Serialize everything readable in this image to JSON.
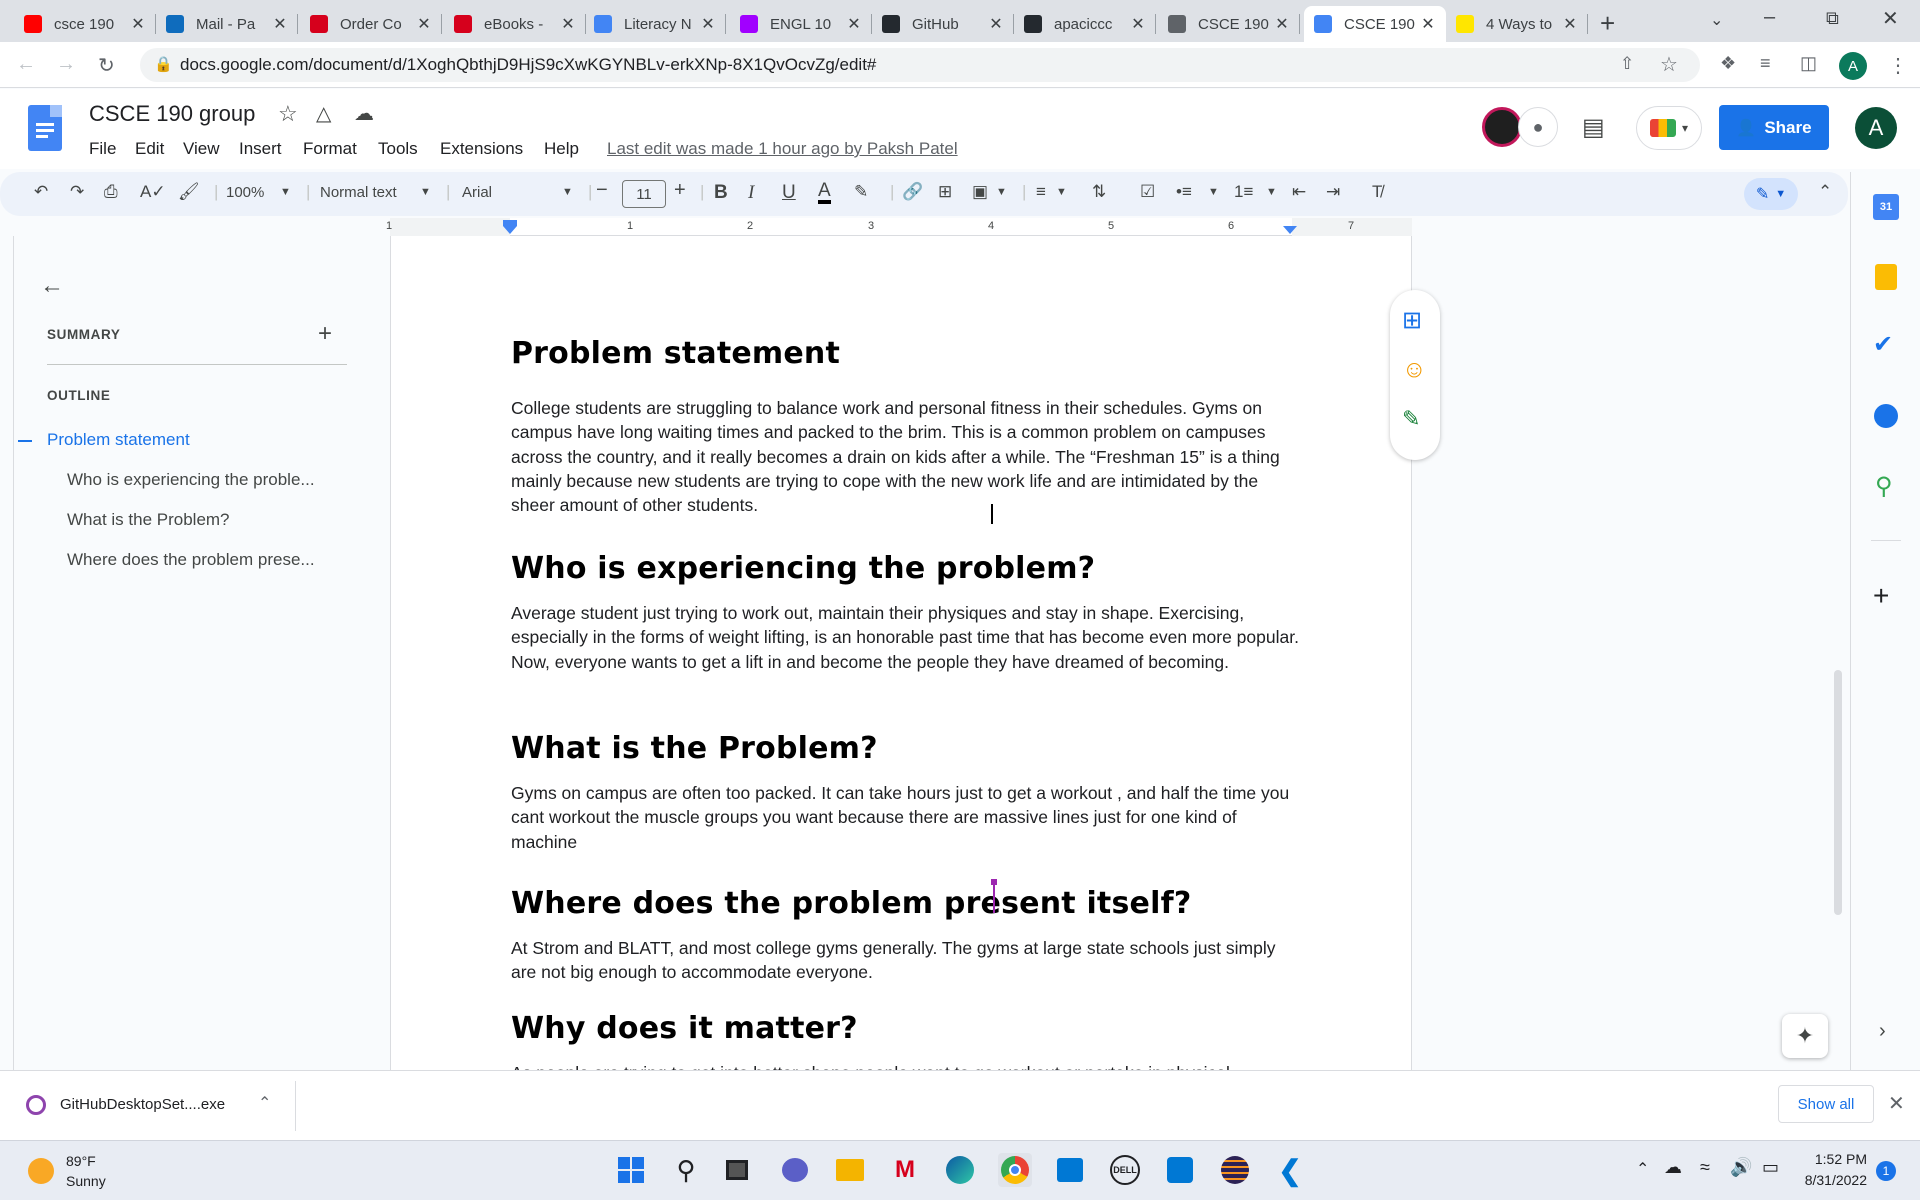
{
  "browser": {
    "tabs": [
      {
        "title": "csce 190",
        "icon": "youtube-icon",
        "color": "#ff0000"
      },
      {
        "title": "Mail - Pa",
        "icon": "outlook-icon",
        "color": "#0f6cbd"
      },
      {
        "title": "Order Co",
        "icon": "mcgraw-hill-icon",
        "color": "#d6001c"
      },
      {
        "title": "eBooks -",
        "icon": "mcgraw-hill-icon",
        "color": "#d6001c"
      },
      {
        "title": "Literacy N",
        "icon": "google-docs-icon",
        "color": "#4285f4"
      },
      {
        "title": "ENGL 10",
        "icon": "tophat-icon",
        "color": "#a100ff"
      },
      {
        "title": "GitHub",
        "icon": "github-icon",
        "color": "#24292f"
      },
      {
        "title": "apaciccc",
        "icon": "github-icon",
        "color": "#24292f"
      },
      {
        "title": "CSCE 190",
        "icon": "globe-icon",
        "color": "#5f6368"
      },
      {
        "title": "CSCE 190",
        "icon": "google-docs-icon",
        "color": "#4285f4"
      },
      {
        "title": "4 Ways to",
        "icon": "wikihow-icon",
        "color": "#ffe600"
      }
    ],
    "url": "docs.google.com/document/d/1XoghQbthjD9HjS9cXwKGYNBLv-erkXNp-8X1QvOcvZg/edit#",
    "profile_initial": "A"
  },
  "docs": {
    "title": "CSCE 190 group",
    "menus": [
      "File",
      "Edit",
      "View",
      "Insert",
      "Format",
      "Tools",
      "Extensions",
      "Help"
    ],
    "last_edit": "Last edit was made 1 hour ago by Paksh Patel",
    "share_label": "Share",
    "account_initial": "A",
    "toolbar": {
      "zoom": "100%",
      "style": "Normal text",
      "font": "Arial",
      "font_size": "11"
    },
    "ruler_numbers": [
      "1",
      "1",
      "2",
      "3",
      "4",
      "5",
      "6",
      "7"
    ]
  },
  "outline_panel": {
    "summary_label": "SUMMARY",
    "outline_label": "OUTLINE",
    "items": [
      {
        "label": "Problem statement",
        "level": 1,
        "active": true
      },
      {
        "label": "Who is experiencing the proble...",
        "level": 2,
        "active": false
      },
      {
        "label": "What is the Problem?",
        "level": 2,
        "active": false
      },
      {
        "label": "Where does the problem prese...",
        "level": 2,
        "active": false
      }
    ]
  },
  "document": {
    "sections": [
      {
        "heading": "Problem statement",
        "body": "College students are struggling to balance work and personal fitness in their schedules. Gyms on campus have long waiting times and packed to the brim. This is a common problem on campuses across the country, and it really becomes a drain on kids after a while. The “Freshman 15” is a thing mainly because new students are trying to cope with the new work life and are intimidated by the sheer amount of other students."
      },
      {
        "heading": "Who is experiencing the problem?",
        "body": "Average student just trying to work out, maintain their physiques and stay in shape. Exercising, especially in the forms of weight lifting, is an honorable past time that has become even more popular. Now, everyone wants to get a lift in and become the people they have dreamed of becoming."
      },
      {
        "heading": "What is the Problem?",
        "body": "Gyms on campus are often too packed. It can take hours just to get a workout , and half the time you cant workout the muscle groups you want because there are massive lines just for one kind of machine"
      },
      {
        "heading": "Where does the problem present itself?",
        "body": "At Strom and BLATT, and most college gyms generally. The gyms at large state schools just simply are not big enough to accommodate everyone."
      },
      {
        "heading": "Why does it matter?",
        "body": "As people are trying to get into better shape people want to go workout or partake in physical"
      }
    ]
  },
  "downloads": {
    "file": "GitHubDesktopSet....exe",
    "show_all": "Show all"
  },
  "taskbar": {
    "weather_temp": "89°F",
    "weather_desc": "Sunny",
    "time": "1:52 PM",
    "date": "8/31/2022",
    "notification_count": "1"
  }
}
